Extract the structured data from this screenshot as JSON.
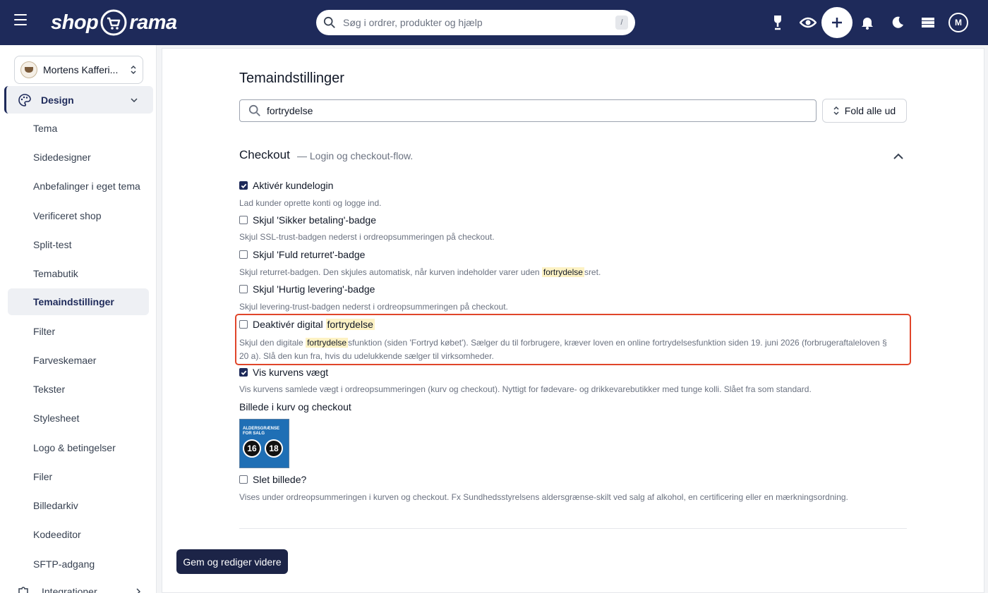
{
  "header": {
    "logo_left": "shop",
    "logo_right": "rama",
    "search_placeholder": "Søg i ordrer, produkter og hjælp",
    "search_shortcut": "/",
    "avatar_initial": "M",
    "icons": [
      "hamburger-icon",
      "trophy-icon",
      "eye-icon",
      "plus-icon",
      "bell-icon",
      "moon-icon",
      "stack-icon",
      "avatar"
    ]
  },
  "sidebar": {
    "shop_name": "Mortens Kafferi...",
    "section": "Design",
    "items": [
      "Tema",
      "Sidedesigner",
      "Anbefalinger i eget tema",
      "Verificeret shop",
      "Split-test",
      "Temabutik",
      "Temaindstillinger",
      "Filter",
      "Farveskemaer",
      "Tekster",
      "Stylesheet",
      "Logo & betingelser",
      "Filer",
      "Billedarkiv",
      "Kodeeditor",
      "SFTP-adgang"
    ],
    "active_item": "Temaindstillinger",
    "next_section": "Integrationer"
  },
  "main": {
    "title": "Temaindstillinger",
    "filter_value": "fortrydelse",
    "fold_button": "Fold alle ud",
    "section_title": "Checkout",
    "section_subtitle": "— Login og checkout-flow.",
    "options": [
      {
        "label": "Aktivér kundelogin",
        "checked": true,
        "help": "Lad kunder oprette konti og logge ind."
      },
      {
        "label": "Skjul 'Sikker betaling'-badge",
        "checked": false,
        "help": "Skjul SSL-trust-badgen nederst i ordreopsummeringen på checkout."
      },
      {
        "label": "Skjul 'Fuld returret'-badge",
        "checked": false,
        "help_pre": "Skjul returret-badgen. Den skjules automatisk, når kurven indeholder varer uden ",
        "help_hl": "fortrydelse",
        "help_post": "sret."
      },
      {
        "label": "Skjul 'Hurtig levering'-badge",
        "checked": false,
        "help": "Skjul levering-trust-badgen nederst i ordreopsummeringen på checkout."
      },
      {
        "label_pre": "Deaktivér digital ",
        "label_hl": "fortrydelse",
        "checked": false,
        "help_pre": "Skjul den digitale ",
        "help_hl": "fortrydelse",
        "help_line1_post": "sfunktion (siden 'Fortryd købet'). Sælger du til forbrugere, kræver loven en online fortrydelsesfunktion siden 19. juni 2026 (forbrugeraftaleloven §",
        "help_line2": "20 a). Slå den kun fra, hvis du udelukkende sælger til virksomheder."
      },
      {
        "label": "Vis kurvens vægt",
        "checked": true,
        "help": "Vis kurvens samlede vægt i ordreopsummeringen (kurv og checkout). Nyttigt for fødevare- og drikkevarebutikker med tunge kolli. Slået fra som standard."
      }
    ],
    "image_label": "Billede i kurv og checkout",
    "thumb_text": "ALDERSGRÆNSE FOR SALG",
    "thumb_age_1": "16",
    "thumb_age_2": "18",
    "delete_image_label": "Slet billede?",
    "delete_image_checked": false,
    "image_help": "Vises under ordreopsummeringen i kurven og checkout. Fx Sundhedsstyrelsens aldersgrænse-skilt ved salg af alkohol, en certificering eller en mærkningsordning.",
    "save_button": "Gem og rediger videre"
  },
  "colors": {
    "header_bg": "#1e2a5a",
    "highlight_border": "#e0452a",
    "text_highlight": "#fdf2c4"
  }
}
